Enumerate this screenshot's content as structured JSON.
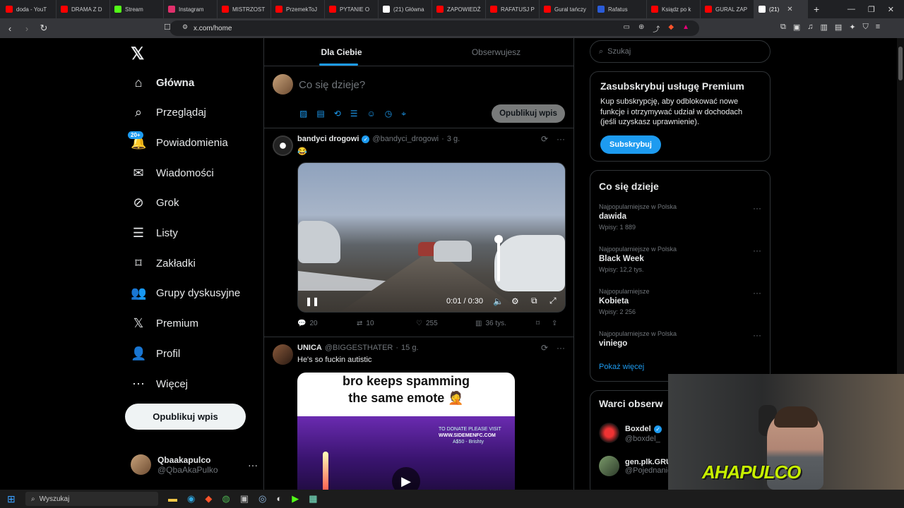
{
  "browser": {
    "tabs": [
      {
        "label": "doda - YouT",
        "color": "#ff0000"
      },
      {
        "label": "DRAMA Z D",
        "color": "#ff0000"
      },
      {
        "label": "Stream",
        "color": "#53fc18"
      },
      {
        "label": "Instagram",
        "color": "#e1306c"
      },
      {
        "label": "MISTRZOST",
        "color": "#ff0000"
      },
      {
        "label": "PrzemekToJ",
        "color": "#ff0000"
      },
      {
        "label": "PYTANIE O",
        "color": "#ff0000"
      },
      {
        "label": "(21) Główna",
        "color": "#ffffff"
      },
      {
        "label": "ZAPOWIEDŹ",
        "color": "#ff0000"
      },
      {
        "label": "RAFATUSJ P",
        "color": "#ff0000"
      },
      {
        "label": "Gural tańczy",
        "color": "#ff0000"
      },
      {
        "label": "Rafatus",
        "color": "#2a5bd7"
      },
      {
        "label": "Ksiądz po k",
        "color": "#ff0000"
      },
      {
        "label": "GURAL ZAP",
        "color": "#ff0000"
      },
      {
        "label": "(21)",
        "color": "#ffffff"
      }
    ],
    "url": "x.com/home"
  },
  "nav": {
    "items": [
      {
        "label": "Główna",
        "icon": "home-icon",
        "bold": true
      },
      {
        "label": "Przeglądaj",
        "icon": "search-icon"
      },
      {
        "label": "Powiadomienia",
        "icon": "bell-icon",
        "badge": "20+"
      },
      {
        "label": "Wiadomości",
        "icon": "mail-icon"
      },
      {
        "label": "Grok",
        "icon": "grok-icon"
      },
      {
        "label": "Listy",
        "icon": "list-icon"
      },
      {
        "label": "Zakładki",
        "icon": "bookmark-icon"
      },
      {
        "label": "Grupy dyskusyjne",
        "icon": "people-icon"
      },
      {
        "label": "Premium",
        "icon": "x-icon"
      },
      {
        "label": "Profil",
        "icon": "person-icon"
      },
      {
        "label": "Więcej",
        "icon": "more-circle-icon"
      }
    ],
    "post_button": "Opublikuj wpis",
    "user": {
      "name": "Qbaakapulco",
      "handle": "@QbaAkaPulko"
    }
  },
  "feed": {
    "tabs": [
      "Dla Ciebie",
      "Obserwujesz"
    ],
    "compose": {
      "placeholder": "Co się dzieje?",
      "button": "Opublikuj wpis"
    },
    "tweets": [
      {
        "name": "bandyci drogowi",
        "handle": "@bandyci_drogowi",
        "time": "3 g.",
        "text": "😂",
        "video_time": "0:01 / 0:30",
        "volume": 1.0,
        "replies": "20",
        "retweets": "10",
        "likes": "255",
        "views": "36 tys."
      },
      {
        "name": "UNICA",
        "handle": "@BIGGESTHATER",
        "time": "15 g.",
        "text": "He's so fuckin autistic",
        "meme_line1": "bro keeps spamming",
        "meme_line2": "the same emote 🤦",
        "donate": "TO DONATE PLEASE VISIT",
        "donate_url": "WWW.SIDEMENFC.COM",
        "donate_amount": "A$50 - Brishty"
      }
    ]
  },
  "sidebar": {
    "search_placeholder": "Szukaj",
    "premium": {
      "title": "Zasubskrybuj usługę Premium",
      "text": "Kup subskrypcję, aby odblokować nowe funkcje i otrzymywać udział w dochodach (jeśli uzyskasz uprawnienie).",
      "button": "Subskrybuj"
    },
    "trends_title": "Co się dzieje",
    "trends": [
      {
        "context": "Najpopularniejsze w Polska",
        "name": "dawida",
        "count": "Wpisy: 1 889"
      },
      {
        "context": "Najpopularniejsze w Polska",
        "name": "Black Week",
        "count": "Wpisy: 12,2 tys."
      },
      {
        "context": "Najpopularniejsze",
        "name": "Kobieta",
        "count": "Wpisy: 2 256"
      },
      {
        "context": "Najpopularniejsze w Polska",
        "name": "viniego",
        "count": ""
      }
    ],
    "show_more": "Pokaż więcej",
    "follow_title": "Warci obserw",
    "follow": [
      {
        "name": "Boxdel",
        "handle": "@boxdel_"
      },
      {
        "name": "gen.plk.GRU",
        "handle": "@Pojednanie"
      }
    ]
  },
  "overlay": {
    "logo": "AHAPULCO"
  },
  "taskbar": {
    "search": "Wyszukaj"
  }
}
